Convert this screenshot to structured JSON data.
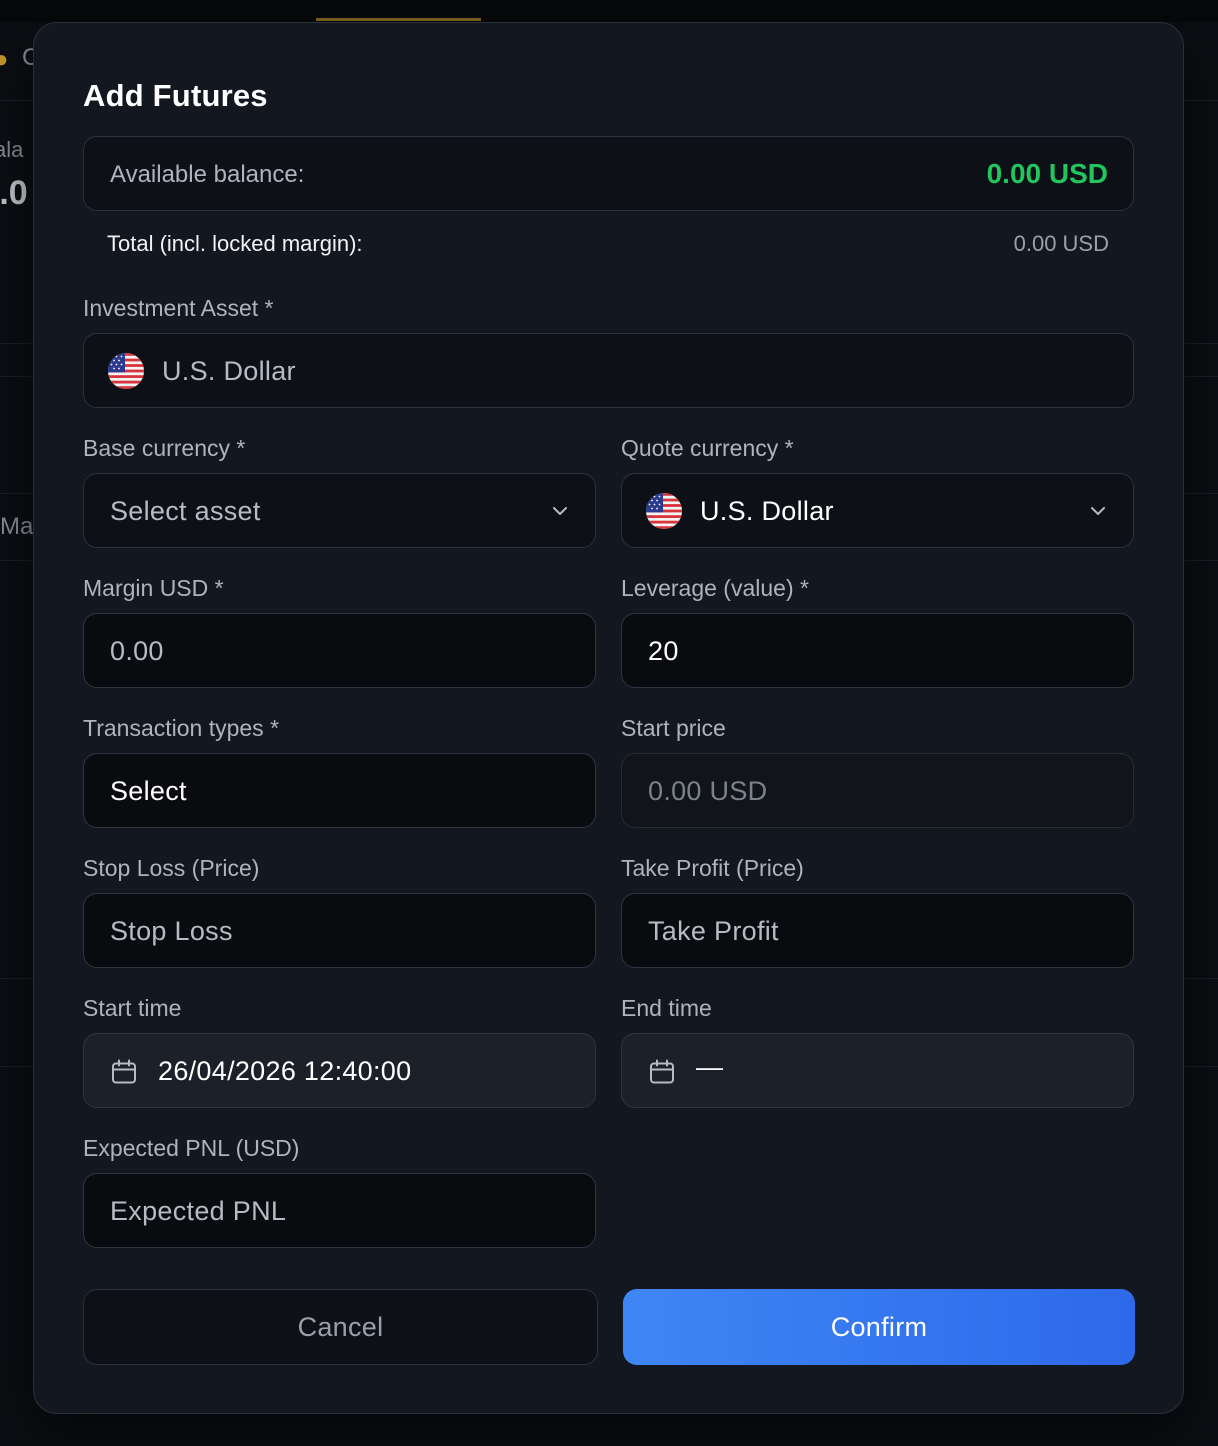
{
  "background": {
    "fragments": [
      "C",
      "ala",
      ").0",
      "Ma"
    ]
  },
  "modal": {
    "title": "Add Futures",
    "balance": {
      "label": "Available balance:",
      "value": "0.00 USD",
      "value_color": "#22c55e"
    },
    "total": {
      "label": "Total (incl. locked margin):",
      "value": "0.00 USD"
    },
    "investment_asset": {
      "label": "Investment Asset *",
      "value": "U.S. Dollar",
      "icon": "us-flag-icon"
    },
    "base_currency": {
      "label": "Base currency *",
      "placeholder": "Select asset",
      "icon": "chevron-down-icon"
    },
    "quote_currency": {
      "label": "Quote currency *",
      "value": "U.S. Dollar",
      "icon": "us-flag-icon"
    },
    "margin": {
      "label": "Margin USD *",
      "placeholder": "0.00"
    },
    "leverage": {
      "label": "Leverage (value) *",
      "value": "20"
    },
    "transaction_types": {
      "label": "Transaction types *",
      "value": "Select"
    },
    "start_price": {
      "label": "Start price",
      "placeholder": "0.00 USD"
    },
    "stop_loss": {
      "label": "Stop Loss (Price)",
      "placeholder": "Stop Loss"
    },
    "take_profit": {
      "label": "Take Profit (Price)",
      "placeholder": "Take Profit"
    },
    "start_time": {
      "label": "Start time",
      "value": "26/04/2026 12:40:00",
      "icon": "calendar-icon"
    },
    "end_time": {
      "label": "End time",
      "value": "—",
      "icon": "calendar-icon"
    },
    "expected_pnl": {
      "label": "Expected PNL (USD)",
      "placeholder": "Expected PNL"
    },
    "buttons": {
      "cancel": "Cancel",
      "confirm": "Confirm"
    },
    "colors": {
      "accent": "#3b82f6",
      "surface": "#131720",
      "field": "#0d1016"
    }
  }
}
